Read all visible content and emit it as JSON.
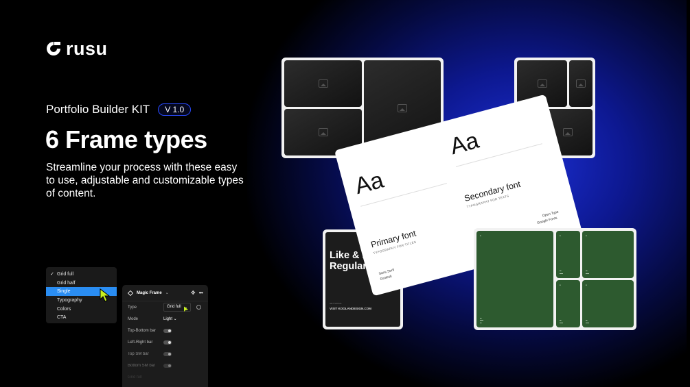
{
  "brand": {
    "logo_text": "rusu"
  },
  "hero": {
    "kit_title": "Portfolio Builder KIT",
    "version": "V 1.0",
    "headline": "6 Frame types",
    "description": "Streamline your process with these easy to use, adjustable and customizable types of content."
  },
  "dropdown": {
    "items": [
      {
        "label": "Grid full",
        "checked": true
      },
      {
        "label": "Grid half"
      },
      {
        "label": "Single",
        "selected": true
      },
      {
        "label": "Typography"
      },
      {
        "label": "Colors"
      },
      {
        "label": "CTA"
      }
    ]
  },
  "panel": {
    "title": "Magic Frame",
    "rows": {
      "type_label": "Type",
      "type_value": "Grid full",
      "mode_label": "Mode",
      "mode_value": "Light",
      "top_bottom_label": "Top-Bottom bar",
      "left_right_label": "Left-Right bar",
      "top_sm_label": "Top SM bar",
      "bottom_sm_label": "Bottom SM bar",
      "grid_full_label": "Grid full"
    }
  },
  "typography_card": {
    "aa_primary": "Aa",
    "aa_secondary": "Aa",
    "primary_font": "Primary font",
    "primary_caption": "TYPOGRAPHY FOR TITLES",
    "secondary_font": "Secondary font",
    "secondary_caption": "TYPOGRAPHY FOR TEXTS",
    "primary_meta": [
      "Sans Serif",
      "Grotesk"
    ],
    "secondary_meta": [
      "Open Type",
      "Google Fonts"
    ]
  },
  "cta_card": {
    "headline": "Like & Follow for Regular Updates",
    "label": "GET SOCIAL",
    "url": "VISIT KOOLANDESIGN.COM"
  },
  "colors": {
    "accent_blue": "#1c2fd6",
    "selection_blue": "#2a8df2",
    "palette_green": "#2d5a2f",
    "cursor_yellow": "#c8f01e"
  }
}
